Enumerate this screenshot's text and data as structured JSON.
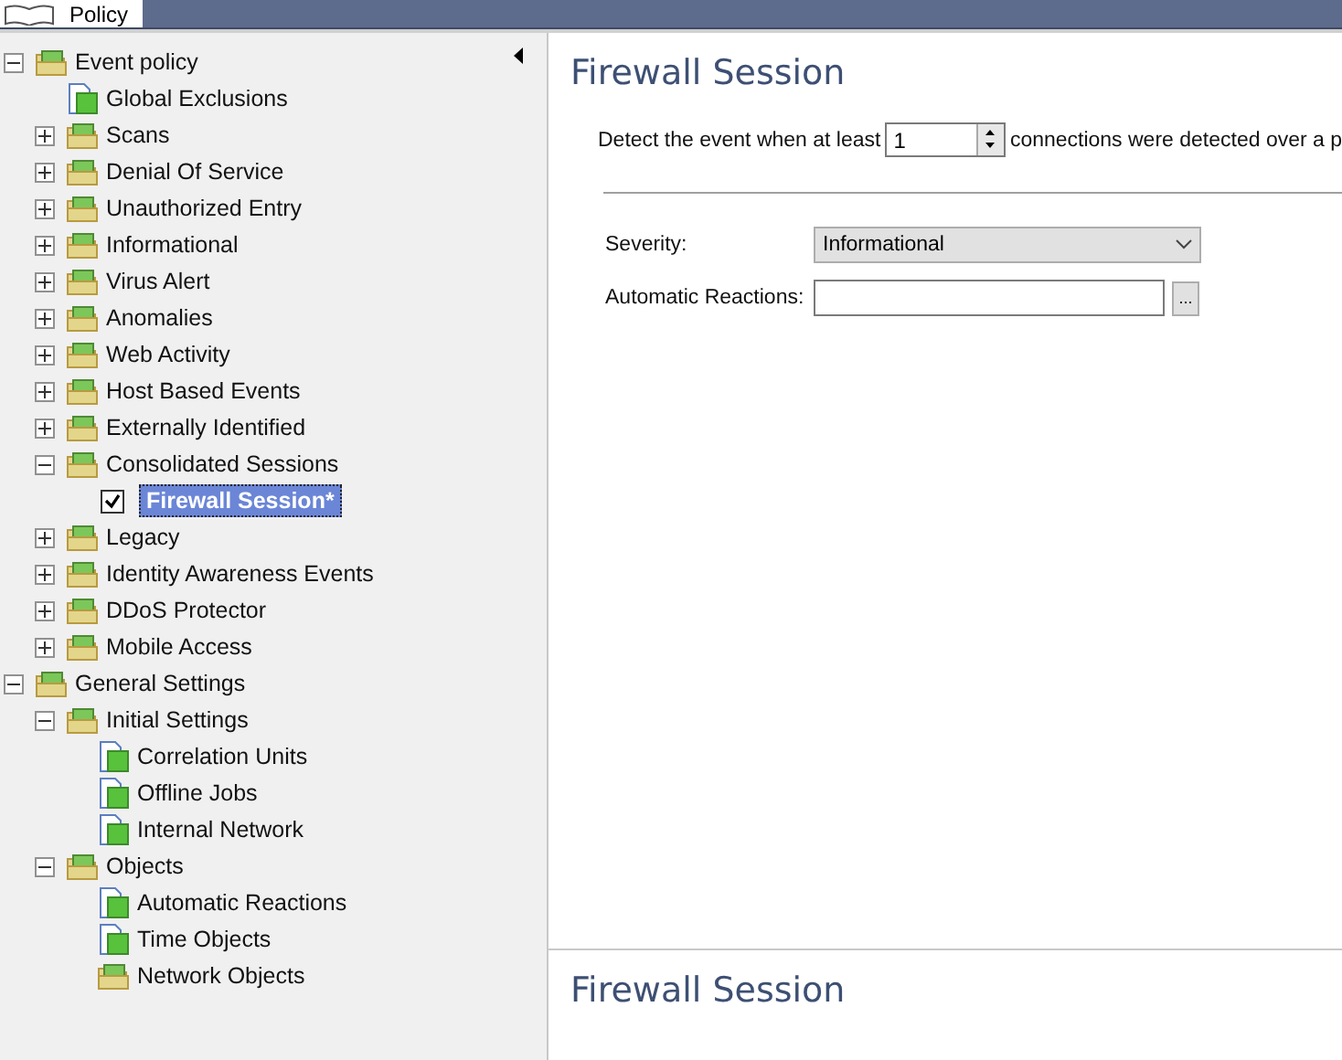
{
  "tab": {
    "label": "Policy",
    "selected": true
  },
  "tree": [
    {
      "label": "Event policy",
      "kind": "folder",
      "expanded": true,
      "children": [
        {
          "label": "Global Exclusions",
          "kind": "page"
        },
        {
          "label": "Scans",
          "kind": "folder",
          "expanded": false
        },
        {
          "label": "Denial Of Service",
          "kind": "folder",
          "expanded": false
        },
        {
          "label": "Unauthorized Entry",
          "kind": "folder",
          "expanded": false
        },
        {
          "label": "Informational",
          "kind": "folder",
          "expanded": false
        },
        {
          "label": "Virus Alert",
          "kind": "folder",
          "expanded": false
        },
        {
          "label": "Anomalies",
          "kind": "folder",
          "expanded": false
        },
        {
          "label": "Web Activity",
          "kind": "folder",
          "expanded": false
        },
        {
          "label": "Host Based Events",
          "kind": "folder",
          "expanded": false
        },
        {
          "label": "Externally Identified",
          "kind": "folder",
          "expanded": false
        },
        {
          "label": "Consolidated Sessions",
          "kind": "folder",
          "expanded": true,
          "children": [
            {
              "label": "Firewall Session*",
              "kind": "check",
              "checked": true,
              "selected": true
            }
          ]
        },
        {
          "label": "Legacy",
          "kind": "folder",
          "expanded": false
        },
        {
          "label": "Identity Awareness Events",
          "kind": "folder",
          "expanded": false
        },
        {
          "label": "DDoS Protector",
          "kind": "folder",
          "expanded": false
        },
        {
          "label": "Mobile Access",
          "kind": "folder",
          "expanded": false
        }
      ]
    },
    {
      "label": "General Settings",
      "kind": "folder",
      "expanded": true,
      "children": [
        {
          "label": "Initial Settings",
          "kind": "folder",
          "expanded": true,
          "children": [
            {
              "label": "Correlation Units",
              "kind": "page"
            },
            {
              "label": "Offline Jobs",
              "kind": "page"
            },
            {
              "label": "Internal Network",
              "kind": "page"
            }
          ]
        },
        {
          "label": "Objects",
          "kind": "folder",
          "expanded": true,
          "children": [
            {
              "label": "Automatic Reactions",
              "kind": "page"
            },
            {
              "label": "Time Objects",
              "kind": "page"
            },
            {
              "label": "Network Objects",
              "kind": "folder"
            }
          ]
        }
      ]
    }
  ],
  "detail": {
    "title": "Firewall Session",
    "detect_before": "Detect the event when at least",
    "count": "1",
    "detect_after": "connections were detected over a p",
    "severity_label": "Severity:",
    "severity": "Informational",
    "reactions_label": "Automatic Reactions:",
    "browse": "...",
    "bottom_title": "Firewall Session"
  }
}
